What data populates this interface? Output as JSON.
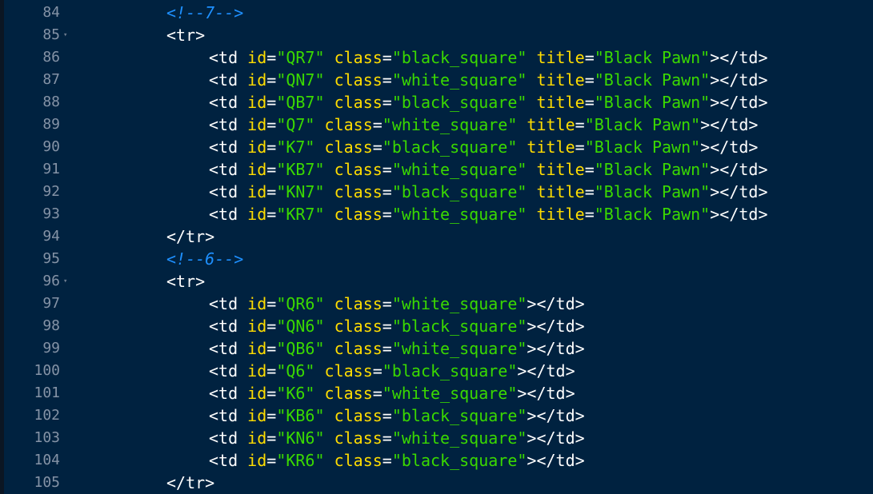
{
  "theme_colors": {
    "background": "#002240",
    "line_number": "#8593a6",
    "tag": "#ffffff",
    "attribute": "#ffdd00",
    "string": "#3ad900",
    "comment": "#1e90ff"
  },
  "lines": [
    {
      "num": "84",
      "fold": false,
      "indent": 2,
      "tokens": [
        {
          "t": "comment",
          "v": "<!--7-->"
        }
      ]
    },
    {
      "num": "85",
      "fold": true,
      "indent": 2,
      "tokens": [
        {
          "t": "tag",
          "v": "<tr>"
        }
      ]
    },
    {
      "num": "86",
      "fold": false,
      "indent": 3,
      "tokens": [
        {
          "t": "tag",
          "v": "<td"
        },
        {
          "t": "sp",
          "v": " "
        },
        {
          "t": "attr",
          "v": "id"
        },
        {
          "t": "punct",
          "v": "="
        },
        {
          "t": "str",
          "v": "\"QR7\""
        },
        {
          "t": "sp",
          "v": " "
        },
        {
          "t": "attr",
          "v": "class"
        },
        {
          "t": "punct",
          "v": "="
        },
        {
          "t": "str",
          "v": "\"black_square\""
        },
        {
          "t": "sp",
          "v": " "
        },
        {
          "t": "attr",
          "v": "title"
        },
        {
          "t": "punct",
          "v": "="
        },
        {
          "t": "str",
          "v": "\"Black Pawn\""
        },
        {
          "t": "tag",
          "v": "></td>"
        }
      ]
    },
    {
      "num": "87",
      "fold": false,
      "indent": 3,
      "tokens": [
        {
          "t": "tag",
          "v": "<td"
        },
        {
          "t": "sp",
          "v": " "
        },
        {
          "t": "attr",
          "v": "id"
        },
        {
          "t": "punct",
          "v": "="
        },
        {
          "t": "str",
          "v": "\"QN7\""
        },
        {
          "t": "sp",
          "v": " "
        },
        {
          "t": "attr",
          "v": "class"
        },
        {
          "t": "punct",
          "v": "="
        },
        {
          "t": "str",
          "v": "\"white_square\""
        },
        {
          "t": "sp",
          "v": " "
        },
        {
          "t": "attr",
          "v": "title"
        },
        {
          "t": "punct",
          "v": "="
        },
        {
          "t": "str",
          "v": "\"Black Pawn\""
        },
        {
          "t": "tag",
          "v": "></td>"
        }
      ]
    },
    {
      "num": "88",
      "fold": false,
      "indent": 3,
      "tokens": [
        {
          "t": "tag",
          "v": "<td"
        },
        {
          "t": "sp",
          "v": " "
        },
        {
          "t": "attr",
          "v": "id"
        },
        {
          "t": "punct",
          "v": "="
        },
        {
          "t": "str",
          "v": "\"QB7\""
        },
        {
          "t": "sp",
          "v": " "
        },
        {
          "t": "attr",
          "v": "class"
        },
        {
          "t": "punct",
          "v": "="
        },
        {
          "t": "str",
          "v": "\"black_square\""
        },
        {
          "t": "sp",
          "v": " "
        },
        {
          "t": "attr",
          "v": "title"
        },
        {
          "t": "punct",
          "v": "="
        },
        {
          "t": "str",
          "v": "\"Black Pawn\""
        },
        {
          "t": "tag",
          "v": "></td>"
        }
      ]
    },
    {
      "num": "89",
      "fold": false,
      "indent": 3,
      "tokens": [
        {
          "t": "tag",
          "v": "<td"
        },
        {
          "t": "sp",
          "v": " "
        },
        {
          "t": "attr",
          "v": "id"
        },
        {
          "t": "punct",
          "v": "="
        },
        {
          "t": "str",
          "v": "\"Q7\""
        },
        {
          "t": "sp",
          "v": " "
        },
        {
          "t": "attr",
          "v": "class"
        },
        {
          "t": "punct",
          "v": "="
        },
        {
          "t": "str",
          "v": "\"white_square\""
        },
        {
          "t": "sp",
          "v": " "
        },
        {
          "t": "attr",
          "v": "title"
        },
        {
          "t": "punct",
          "v": "="
        },
        {
          "t": "str",
          "v": "\"Black Pawn\""
        },
        {
          "t": "tag",
          "v": "></td>"
        }
      ]
    },
    {
      "num": "90",
      "fold": false,
      "indent": 3,
      "tokens": [
        {
          "t": "tag",
          "v": "<td"
        },
        {
          "t": "sp",
          "v": " "
        },
        {
          "t": "attr",
          "v": "id"
        },
        {
          "t": "punct",
          "v": "="
        },
        {
          "t": "str",
          "v": "\"K7\""
        },
        {
          "t": "sp",
          "v": " "
        },
        {
          "t": "attr",
          "v": "class"
        },
        {
          "t": "punct",
          "v": "="
        },
        {
          "t": "str",
          "v": "\"black_square\""
        },
        {
          "t": "sp",
          "v": " "
        },
        {
          "t": "attr",
          "v": "title"
        },
        {
          "t": "punct",
          "v": "="
        },
        {
          "t": "str",
          "v": "\"Black Pawn\""
        },
        {
          "t": "tag",
          "v": "></td>"
        }
      ]
    },
    {
      "num": "91",
      "fold": false,
      "indent": 3,
      "tokens": [
        {
          "t": "tag",
          "v": "<td"
        },
        {
          "t": "sp",
          "v": " "
        },
        {
          "t": "attr",
          "v": "id"
        },
        {
          "t": "punct",
          "v": "="
        },
        {
          "t": "str",
          "v": "\"KB7\""
        },
        {
          "t": "sp",
          "v": " "
        },
        {
          "t": "attr",
          "v": "class"
        },
        {
          "t": "punct",
          "v": "="
        },
        {
          "t": "str",
          "v": "\"white_square\""
        },
        {
          "t": "sp",
          "v": " "
        },
        {
          "t": "attr",
          "v": "title"
        },
        {
          "t": "punct",
          "v": "="
        },
        {
          "t": "str",
          "v": "\"Black Pawn\""
        },
        {
          "t": "tag",
          "v": "></td>"
        }
      ]
    },
    {
      "num": "92",
      "fold": false,
      "indent": 3,
      "tokens": [
        {
          "t": "tag",
          "v": "<td"
        },
        {
          "t": "sp",
          "v": " "
        },
        {
          "t": "attr",
          "v": "id"
        },
        {
          "t": "punct",
          "v": "="
        },
        {
          "t": "str",
          "v": "\"KN7\""
        },
        {
          "t": "sp",
          "v": " "
        },
        {
          "t": "attr",
          "v": "class"
        },
        {
          "t": "punct",
          "v": "="
        },
        {
          "t": "str",
          "v": "\"black_square\""
        },
        {
          "t": "sp",
          "v": " "
        },
        {
          "t": "attr",
          "v": "title"
        },
        {
          "t": "punct",
          "v": "="
        },
        {
          "t": "str",
          "v": "\"Black Pawn\""
        },
        {
          "t": "tag",
          "v": "></td>"
        }
      ]
    },
    {
      "num": "93",
      "fold": false,
      "indent": 3,
      "tokens": [
        {
          "t": "tag",
          "v": "<td"
        },
        {
          "t": "sp",
          "v": " "
        },
        {
          "t": "attr",
          "v": "id"
        },
        {
          "t": "punct",
          "v": "="
        },
        {
          "t": "str",
          "v": "\"KR7\""
        },
        {
          "t": "sp",
          "v": " "
        },
        {
          "t": "attr",
          "v": "class"
        },
        {
          "t": "punct",
          "v": "="
        },
        {
          "t": "str",
          "v": "\"white_square\""
        },
        {
          "t": "sp",
          "v": " "
        },
        {
          "t": "attr",
          "v": "title"
        },
        {
          "t": "punct",
          "v": "="
        },
        {
          "t": "str",
          "v": "\"Black Pawn\""
        },
        {
          "t": "tag",
          "v": "></td>"
        }
      ]
    },
    {
      "num": "94",
      "fold": false,
      "indent": 2,
      "tokens": [
        {
          "t": "tag",
          "v": "</tr>"
        }
      ]
    },
    {
      "num": "95",
      "fold": false,
      "indent": 2,
      "tokens": [
        {
          "t": "comment",
          "v": "<!--6-->"
        }
      ]
    },
    {
      "num": "96",
      "fold": true,
      "indent": 2,
      "tokens": [
        {
          "t": "tag",
          "v": "<tr>"
        }
      ]
    },
    {
      "num": "97",
      "fold": false,
      "indent": 3,
      "tokens": [
        {
          "t": "tag",
          "v": "<td"
        },
        {
          "t": "sp",
          "v": " "
        },
        {
          "t": "attr",
          "v": "id"
        },
        {
          "t": "punct",
          "v": "="
        },
        {
          "t": "str",
          "v": "\"QR6\""
        },
        {
          "t": "sp",
          "v": " "
        },
        {
          "t": "attr",
          "v": "class"
        },
        {
          "t": "punct",
          "v": "="
        },
        {
          "t": "str",
          "v": "\"white_square\""
        },
        {
          "t": "tag",
          "v": "></td>"
        }
      ]
    },
    {
      "num": "98",
      "fold": false,
      "indent": 3,
      "tokens": [
        {
          "t": "tag",
          "v": "<td"
        },
        {
          "t": "sp",
          "v": " "
        },
        {
          "t": "attr",
          "v": "id"
        },
        {
          "t": "punct",
          "v": "="
        },
        {
          "t": "str",
          "v": "\"QN6\""
        },
        {
          "t": "sp",
          "v": " "
        },
        {
          "t": "attr",
          "v": "class"
        },
        {
          "t": "punct",
          "v": "="
        },
        {
          "t": "str",
          "v": "\"black_square\""
        },
        {
          "t": "tag",
          "v": "></td>"
        }
      ]
    },
    {
      "num": "99",
      "fold": false,
      "indent": 3,
      "tokens": [
        {
          "t": "tag",
          "v": "<td"
        },
        {
          "t": "sp",
          "v": " "
        },
        {
          "t": "attr",
          "v": "id"
        },
        {
          "t": "punct",
          "v": "="
        },
        {
          "t": "str",
          "v": "\"QB6\""
        },
        {
          "t": "sp",
          "v": " "
        },
        {
          "t": "attr",
          "v": "class"
        },
        {
          "t": "punct",
          "v": "="
        },
        {
          "t": "str",
          "v": "\"white_square\""
        },
        {
          "t": "tag",
          "v": "></td>"
        }
      ]
    },
    {
      "num": "100",
      "fold": false,
      "indent": 3,
      "tokens": [
        {
          "t": "tag",
          "v": "<td"
        },
        {
          "t": "sp",
          "v": " "
        },
        {
          "t": "attr",
          "v": "id"
        },
        {
          "t": "punct",
          "v": "="
        },
        {
          "t": "str",
          "v": "\"Q6\""
        },
        {
          "t": "sp",
          "v": " "
        },
        {
          "t": "attr",
          "v": "class"
        },
        {
          "t": "punct",
          "v": "="
        },
        {
          "t": "str",
          "v": "\"black_square\""
        },
        {
          "t": "tag",
          "v": "></td>"
        }
      ]
    },
    {
      "num": "101",
      "fold": false,
      "indent": 3,
      "tokens": [
        {
          "t": "tag",
          "v": "<td"
        },
        {
          "t": "sp",
          "v": " "
        },
        {
          "t": "attr",
          "v": "id"
        },
        {
          "t": "punct",
          "v": "="
        },
        {
          "t": "str",
          "v": "\"K6\""
        },
        {
          "t": "sp",
          "v": " "
        },
        {
          "t": "attr",
          "v": "class"
        },
        {
          "t": "punct",
          "v": "="
        },
        {
          "t": "str",
          "v": "\"white_square\""
        },
        {
          "t": "tag",
          "v": "></td>"
        }
      ]
    },
    {
      "num": "102",
      "fold": false,
      "indent": 3,
      "tokens": [
        {
          "t": "tag",
          "v": "<td"
        },
        {
          "t": "sp",
          "v": " "
        },
        {
          "t": "attr",
          "v": "id"
        },
        {
          "t": "punct",
          "v": "="
        },
        {
          "t": "str",
          "v": "\"KB6\""
        },
        {
          "t": "sp",
          "v": " "
        },
        {
          "t": "attr",
          "v": "class"
        },
        {
          "t": "punct",
          "v": "="
        },
        {
          "t": "str",
          "v": "\"black_square\""
        },
        {
          "t": "tag",
          "v": "></td>"
        }
      ]
    },
    {
      "num": "103",
      "fold": false,
      "indent": 3,
      "tokens": [
        {
          "t": "tag",
          "v": "<td"
        },
        {
          "t": "sp",
          "v": " "
        },
        {
          "t": "attr",
          "v": "id"
        },
        {
          "t": "punct",
          "v": "="
        },
        {
          "t": "str",
          "v": "\"KN6\""
        },
        {
          "t": "sp",
          "v": " "
        },
        {
          "t": "attr",
          "v": "class"
        },
        {
          "t": "punct",
          "v": "="
        },
        {
          "t": "str",
          "v": "\"white_square\""
        },
        {
          "t": "tag",
          "v": "></td>"
        }
      ]
    },
    {
      "num": "104",
      "fold": false,
      "indent": 3,
      "tokens": [
        {
          "t": "tag",
          "v": "<td"
        },
        {
          "t": "sp",
          "v": " "
        },
        {
          "t": "attr",
          "v": "id"
        },
        {
          "t": "punct",
          "v": "="
        },
        {
          "t": "str",
          "v": "\"KR6\""
        },
        {
          "t": "sp",
          "v": " "
        },
        {
          "t": "attr",
          "v": "class"
        },
        {
          "t": "punct",
          "v": "="
        },
        {
          "t": "str",
          "v": "\"black_square\""
        },
        {
          "t": "tag",
          "v": "></td>"
        }
      ]
    },
    {
      "num": "105",
      "fold": false,
      "indent": 2,
      "tokens": [
        {
          "t": "tag",
          "v": "</tr>"
        }
      ]
    }
  ]
}
